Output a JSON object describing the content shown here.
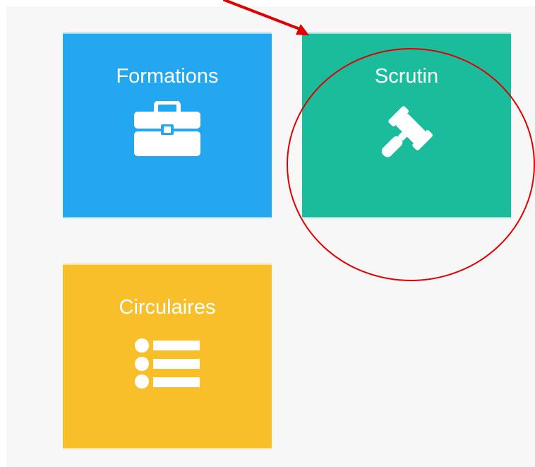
{
  "tiles": {
    "formations": {
      "label": "Formations",
      "color": "#22a7f0",
      "icon": "briefcase-icon"
    },
    "scrutin": {
      "label": "Scrutin",
      "color": "#1abc9c",
      "icon": "gavel-icon"
    },
    "circulaires": {
      "label": "Circulaires",
      "color": "#f9bf2a",
      "icon": "list-icon"
    }
  },
  "annotation": {
    "color": "#e00000",
    "shapes": [
      "arrow",
      "circle"
    ]
  },
  "colors": {
    "background": "#f7f7f7",
    "text": "#ffffff"
  }
}
